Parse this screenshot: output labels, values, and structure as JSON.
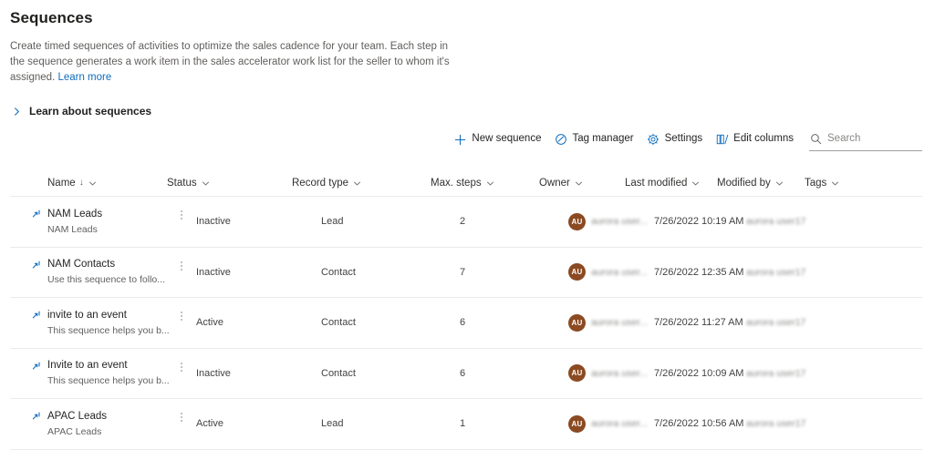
{
  "page": {
    "title": "Sequences",
    "description_part1": "Create timed sequences of activities to optimize the sales cadence for your team. Each step in the sequence generates a work item in the sales accelerator work list for the seller to whom it's assigned. ",
    "learn_more_label": "Learn more",
    "expander_label": "Learn about sequences"
  },
  "toolbar": {
    "new_sequence_label": "New sequence",
    "tag_manager_label": "Tag manager",
    "settings_label": "Settings",
    "edit_columns_label": "Edit columns",
    "search_placeholder": "Search",
    "search_value": ""
  },
  "columns": [
    {
      "key": "name",
      "label": "Name",
      "sorted": true,
      "sort_glyph": "↓"
    },
    {
      "key": "status",
      "label": "Status"
    },
    {
      "key": "record_type",
      "label": "Record type"
    },
    {
      "key": "max_steps",
      "label": "Max. steps"
    },
    {
      "key": "owner",
      "label": "Owner"
    },
    {
      "key": "last_modified",
      "label": "Last modified"
    },
    {
      "key": "modified_by",
      "label": "Modified by"
    },
    {
      "key": "tags",
      "label": "Tags"
    }
  ],
  "rows": [
    {
      "name": "NAM Leads",
      "description": "NAM Leads",
      "status": "Inactive",
      "record_type": "Lead",
      "max_steps": "2",
      "owner_initials": "AU",
      "owner_name": "aurora user...",
      "last_modified": "7/26/2022 10:19 AM",
      "modified_by": "aurora user17",
      "tags": ""
    },
    {
      "name": "NAM Contacts",
      "description": "Use this sequence to follo...",
      "status": "Inactive",
      "record_type": "Contact",
      "max_steps": "7",
      "owner_initials": "AU",
      "owner_name": "aurora user...",
      "last_modified": "7/26/2022 12:35 AM",
      "modified_by": "aurora user17",
      "tags": ""
    },
    {
      "name": "invite to an event",
      "description": "This sequence helps you b...",
      "status": "Active",
      "record_type": "Contact",
      "max_steps": "6",
      "owner_initials": "AU",
      "owner_name": "aurora user...",
      "last_modified": "7/26/2022 11:27 AM",
      "modified_by": "aurora user17",
      "tags": ""
    },
    {
      "name": "Invite to an event",
      "description": "This sequence helps you b...",
      "status": "Inactive",
      "record_type": "Contact",
      "max_steps": "6",
      "owner_initials": "AU",
      "owner_name": "aurora user...",
      "last_modified": "7/26/2022 10:09 AM",
      "modified_by": "aurora user17",
      "tags": ""
    },
    {
      "name": "APAC Leads",
      "description": "APAC Leads",
      "status": "Active",
      "record_type": "Lead",
      "max_steps": "1",
      "owner_initials": "AU",
      "owner_name": "aurora user...",
      "last_modified": "7/26/2022 10:56 AM",
      "modified_by": "aurora user17",
      "tags": ""
    }
  ],
  "colors": {
    "accent": "#0f6cbd",
    "link": "#0f6cbd",
    "avatar_bg": "#8b4a21",
    "text_primary": "#242424",
    "text_secondary": "#605e5c",
    "divider": "#edebe9"
  }
}
